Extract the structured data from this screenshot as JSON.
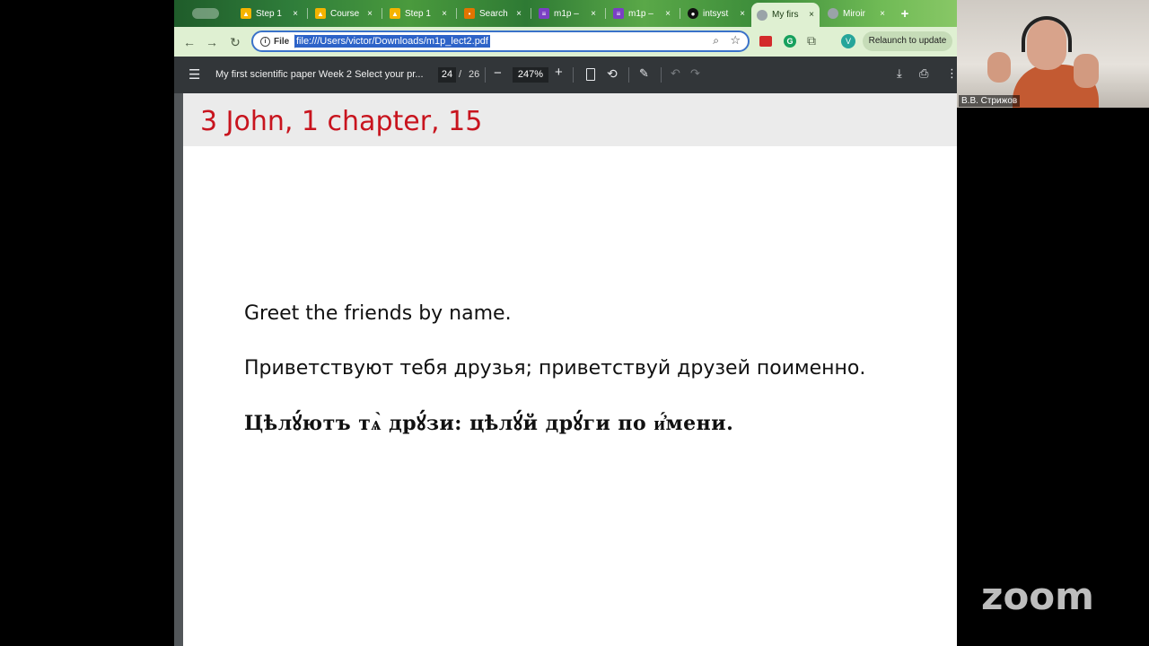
{
  "browser": {
    "tabs": [
      {
        "title": "",
        "favicon": "grey-pill",
        "active": false
      },
      {
        "title": "Step 1",
        "favicon": "drive-icon",
        "active": false
      },
      {
        "title": "Course",
        "favicon": "drive-icon",
        "active": false
      },
      {
        "title": "Step 1",
        "favicon": "drive-icon",
        "active": false
      },
      {
        "title": "Search",
        "favicon": "search-icon",
        "active": false
      },
      {
        "title": "m1p –",
        "favicon": "doc-icon",
        "active": false
      },
      {
        "title": "m1p –",
        "favicon": "doc-icon",
        "active": false
      },
      {
        "title": "intsyst",
        "favicon": "github-icon",
        "active": false
      },
      {
        "title": "My firs",
        "favicon": "globe-icon",
        "active": true
      },
      {
        "title": "Miroir",
        "favicon": "globe-icon",
        "active": false
      }
    ],
    "close_glyph": "×",
    "new_tab_glyph": "+",
    "omnibox": {
      "scheme_chip": "File",
      "url": "file:///Users/victor/Downloads/m1p_lect2.pdf"
    },
    "avatar_letter": "V",
    "relaunch_label": "Relaunch to update"
  },
  "pdf_viewer": {
    "title": "My first scientific paper Week 2 Select your pr...",
    "page_current": "24",
    "page_separator": "/",
    "page_total": "26",
    "zoom": "247%"
  },
  "slide": {
    "title": "3 John, 1 chapter, 15",
    "lines": [
      "Greet the friends by name.",
      "Приветствуют тебя друзья; приветствуй друзей поименно.",
      "Цѣлꙋ́ютъ тѧ̀ дрꙋ́зи: цѣлꙋ́й дрꙋ́ги по и҆́мени."
    ]
  },
  "zoom": {
    "participant_name": "В.В. Стрижов",
    "logo_text": "zoom"
  },
  "colors": {
    "slide_title": "#c8141e",
    "pdf_toolbar": "#323639",
    "browser_toolbar": "#dff0d2",
    "url_highlight": "#2d63c8"
  }
}
